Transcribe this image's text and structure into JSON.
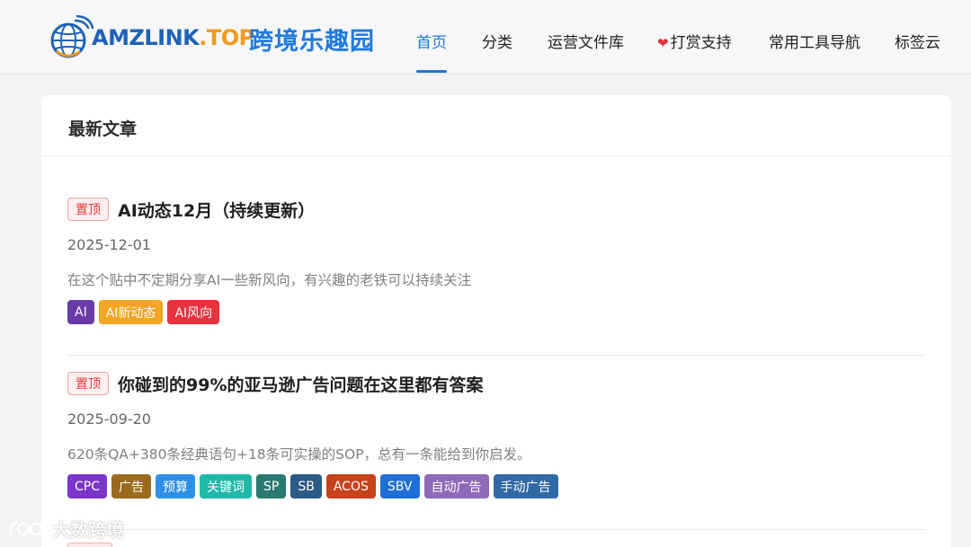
{
  "header": {
    "logo_text_main": "AMZLINK",
    "logo_text_domain": ".TOP",
    "site_name": "跨境乐趣园",
    "nav": [
      {
        "label": "首页",
        "active": true
      },
      {
        "label": "分类",
        "active": false
      },
      {
        "label": "运营文件库",
        "active": false
      },
      {
        "label": "打赏支持",
        "active": false,
        "icon": "heart-icon"
      },
      {
        "label": "常用工具导航",
        "active": false
      },
      {
        "label": "标签云",
        "active": false
      }
    ]
  },
  "main": {
    "section_title": "最新文章",
    "posts": [
      {
        "badge": "置顶",
        "title": "AI动态12月（持续更新）",
        "date": "2025-12-01",
        "excerpt": "在这个贴中不定期分享AI一些新风向，有兴趣的老铁可以持续关注",
        "tags": [
          {
            "label": "AI",
            "color": "#6a3aa8"
          },
          {
            "label": "AI新动态",
            "color": "#f4a623"
          },
          {
            "label": "AI风向",
            "color": "#e8323e"
          }
        ]
      },
      {
        "badge": "置顶",
        "title": "你碰到的99%的亚马逊广告问题在这里都有答案",
        "date": "2025-09-20",
        "excerpt": "620条QA+380条经典语句+18条可实操的SOP，总有一条能给到你启发。",
        "tags": [
          {
            "label": "CPC",
            "color": "#7b35c9"
          },
          {
            "label": "广告",
            "color": "#9a6a1f"
          },
          {
            "label": "预算",
            "color": "#2f8fe6"
          },
          {
            "label": "关键词",
            "color": "#20b8a8"
          },
          {
            "label": "SP",
            "color": "#2a7a72"
          },
          {
            "label": "SB",
            "color": "#2b5a86"
          },
          {
            "label": "ACOS",
            "color": "#c8421c"
          },
          {
            "label": "SBV",
            "color": "#1f6fd6"
          },
          {
            "label": "自动广告",
            "color": "#8f6ab8"
          },
          {
            "label": "手动广告",
            "color": "#3169a6"
          }
        ]
      }
    ]
  },
  "watermark": {
    "text": "大数跨境"
  }
}
